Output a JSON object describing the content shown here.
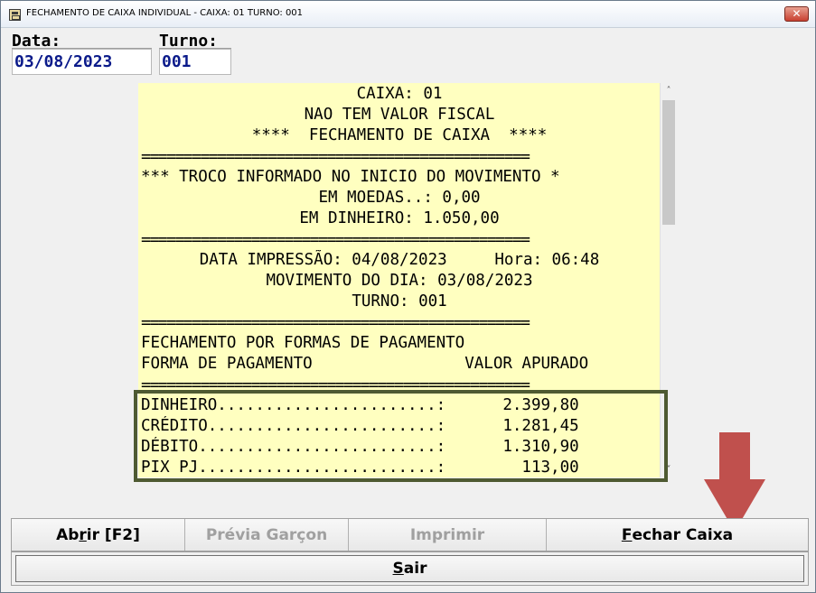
{
  "window": {
    "title": "FECHAMENTO DE CAIXA INDIVIDUAL - CAIXA: 01 TURNO: 001",
    "close_glyph": "✕"
  },
  "fields": {
    "data_label": "Data:",
    "data_value": "03/08/2023",
    "turno_label": "Turno:",
    "turno_value": "001"
  },
  "report": {
    "lines": [
      "CAIXA: 01",
      "NAO TEM VALOR FISCAL",
      "****  FECHAMENTO DE CAIXA  ****",
      "==============================================",
      "*** TROCO INFORMADO NO INICIO DO MOVIMENTO *",
      "EM MOEDAS..: 0,00",
      "EM DINHEIRO: 1.050,00",
      "==============================================",
      "DATA IMPRESSÃO: 04/08/2023     Hora: 06:48",
      "MOVIMENTO DO DIA: 03/08/2023",
      "TURNO: 001",
      "==============================================",
      "FECHAMENTO POR FORMAS DE PAGAMENTO",
      "FORMA DE PAGAMENTO                VALOR APURADO",
      "==============================================",
      "DINHEIRO.......................:      2.399,80",
      "CRÉDITO........................:      1.281,45",
      "DÉBITO.........................:      1.310,90",
      "PIX PJ.........................:        113,00"
    ]
  },
  "scrollbar": {
    "up_glyph": "˄",
    "down_glyph": "˅"
  },
  "buttons": {
    "abrir_pre": "Ab",
    "abrir_accel": "r",
    "abrir_post": "ir [F2]",
    "previa": "Prévia Garçon",
    "imprimir": "Imprimir",
    "fechar_accel": "F",
    "fechar_post": "echar Caixa",
    "sair_accel": "S",
    "sair_post": "air"
  },
  "colors": {
    "report_bg": "#ffffc0",
    "highlight_border": "#4e5a32",
    "arrow": "#c0504d",
    "field_value": "#0a1a8a"
  }
}
